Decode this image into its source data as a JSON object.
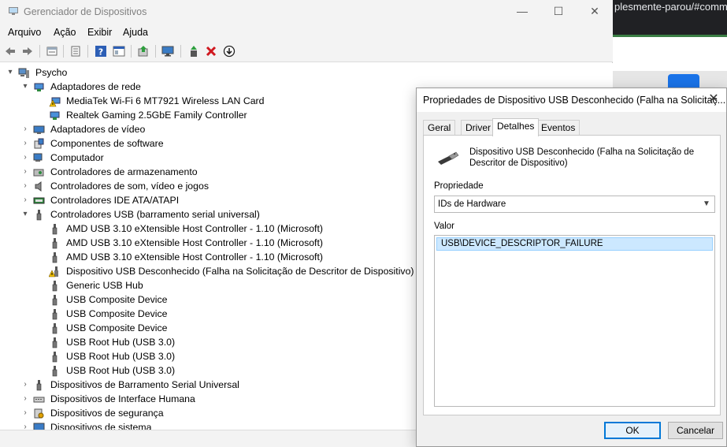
{
  "background_browser": {
    "url_fragment": "plesmente-parou/#comm"
  },
  "window": {
    "title": "Gerenciador de Dispositivos",
    "controls": {
      "minimize": "—",
      "maximize": "☐",
      "close": "✕"
    }
  },
  "menu": [
    "Arquivo",
    "Ação",
    "Exibir",
    "Ajuda"
  ],
  "toolbar": [
    "back-arrow-icon",
    "forward-arrow-icon",
    "properties-icon",
    "list-icon",
    "help-icon",
    "details-icon",
    "update-driver-icon",
    "monitor-icon",
    "enable-device-icon",
    "uninstall-icon",
    "download-icon"
  ],
  "tree": {
    "root": "Psycho",
    "items": [
      {
        "label": "Adaptadores de rede",
        "level": 1,
        "expanded": true,
        "icon": "network-adapter-icon"
      },
      {
        "label": "MediaTek Wi-Fi 6 MT7921 Wireless LAN Card",
        "level": 2,
        "icon": "network-warning-icon"
      },
      {
        "label": "Realtek Gaming 2.5GbE Family Controller",
        "level": 2,
        "icon": "network-adapter-icon"
      },
      {
        "label": "Adaptadores de vídeo",
        "level": 1,
        "expanded": false,
        "icon": "display-adapter-icon"
      },
      {
        "label": "Componentes de software",
        "level": 1,
        "expanded": false,
        "icon": "software-component-icon"
      },
      {
        "label": "Computador",
        "level": 1,
        "expanded": false,
        "icon": "computer-icon"
      },
      {
        "label": "Controladores de armazenamento",
        "level": 1,
        "expanded": false,
        "icon": "storage-controller-icon"
      },
      {
        "label": "Controladores de som, vídeo e jogos",
        "level": 1,
        "expanded": false,
        "icon": "speaker-icon"
      },
      {
        "label": "Controladores IDE ATA/ATAPI",
        "level": 1,
        "expanded": false,
        "icon": "ide-controller-icon"
      },
      {
        "label": "Controladores USB (barramento serial universal)",
        "level": 1,
        "expanded": true,
        "icon": "usb-icon"
      },
      {
        "label": "AMD USB 3.10 eXtensible Host Controller - 1.10 (Microsoft)",
        "level": 2,
        "icon": "usb-icon"
      },
      {
        "label": "AMD USB 3.10 eXtensible Host Controller - 1.10 (Microsoft)",
        "level": 2,
        "icon": "usb-icon"
      },
      {
        "label": "AMD USB 3.10 eXtensible Host Controller - 1.10 (Microsoft)",
        "level": 2,
        "icon": "usb-icon"
      },
      {
        "label": "Dispositivo USB Desconhecido (Falha na Solicitação de Descritor de Dispositivo)",
        "level": 2,
        "icon": "usb-warning-icon"
      },
      {
        "label": "Generic USB Hub",
        "level": 2,
        "icon": "usb-icon"
      },
      {
        "label": "USB Composite Device",
        "level": 2,
        "icon": "usb-icon"
      },
      {
        "label": "USB Composite Device",
        "level": 2,
        "icon": "usb-icon"
      },
      {
        "label": "USB Composite Device",
        "level": 2,
        "icon": "usb-icon"
      },
      {
        "label": "USB Root Hub (USB 3.0)",
        "level": 2,
        "icon": "usb-icon"
      },
      {
        "label": "USB Root Hub (USB 3.0)",
        "level": 2,
        "icon": "usb-icon"
      },
      {
        "label": "USB Root Hub (USB 3.0)",
        "level": 2,
        "icon": "usb-icon"
      },
      {
        "label": "Dispositivos de Barramento Serial Universal",
        "level": 1,
        "expanded": false,
        "icon": "usb-icon"
      },
      {
        "label": "Dispositivos de Interface Humana",
        "level": 1,
        "expanded": false,
        "icon": "hid-icon"
      },
      {
        "label": "Dispositivos de segurança",
        "level": 1,
        "expanded": false,
        "icon": "security-device-icon"
      },
      {
        "label": "Dispositivos de sistema",
        "level": 1,
        "expanded": false,
        "icon": "system-device-icon"
      }
    ]
  },
  "dialog": {
    "title": "Propriedades de Dispositivo USB Desconhecido (Falha na Solicitaç...",
    "close": "✕",
    "tabs": [
      "Geral",
      "Driver",
      "Detalhes",
      "Eventos"
    ],
    "active_tab": "Detalhes",
    "device_name": "Dispositivo USB Desconhecido (Falha na Solicitação de Descritor de Dispositivo)",
    "property_label": "Propriedade",
    "property_value": "IDs de Hardware",
    "value_label": "Valor",
    "values": [
      "USB\\DEVICE_DESCRIPTOR_FAILURE"
    ],
    "ok": "OK",
    "cancel": "Cancelar"
  }
}
